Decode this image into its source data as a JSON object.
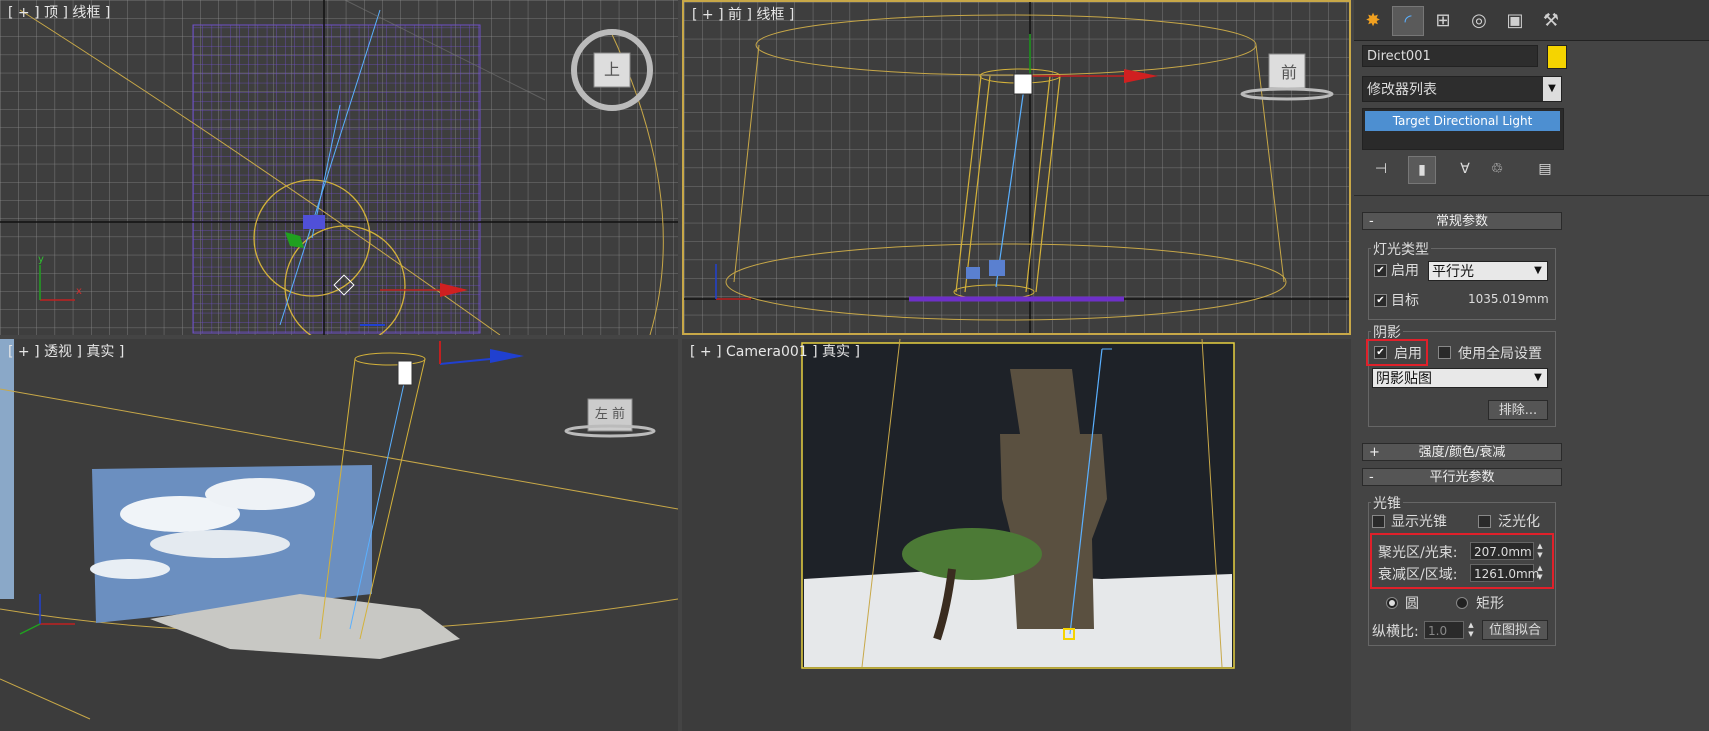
{
  "viewports": {
    "top": {
      "label": "[ + ] 顶 ] 线框 ]",
      "nav_cube": "上"
    },
    "front": {
      "label": "[ + ] 前 ] 线框 ]",
      "nav_cube": "前"
    },
    "perspective": {
      "label": "[ + ] 透视 ] 真实 ]",
      "nav_cube": "左 前"
    },
    "camera": {
      "label": "[ + ] Camera001 ] 真实 ]"
    }
  },
  "panel": {
    "tabs": [
      "create-icon",
      "modify-icon",
      "hierarchy-icon",
      "motion-icon",
      "display-icon",
      "utilities-icon"
    ],
    "object_name": "Direct001",
    "object_color": "#f5d400",
    "modifier_list": "修改器列表",
    "stack_item": "Target Directional Light",
    "general": {
      "sign": "-",
      "title": "常规参数",
      "light_type_group": "灯光类型",
      "on_label": "启用",
      "on_checked": true,
      "light_type": "平行光",
      "target_label": "目标",
      "target_checked": true,
      "target_distance": "1035.019mm",
      "shadows_group": "阴影",
      "shadow_on_label": "启用",
      "shadow_on_checked": true,
      "global_label": "使用全局设置",
      "global_checked": false,
      "shadow_type": "阴影贴图",
      "exclude_button": "排除..."
    },
    "intensity": {
      "sign": "+",
      "title": "强度/颜色/衰减"
    },
    "directional": {
      "sign": "-",
      "title": "平行光参数",
      "cone_group": "光锥",
      "show_cone_label": "显示光锥",
      "show_cone_checked": false,
      "overshoot_label": "泛光化",
      "overshoot_checked": false,
      "hotspot_label": "聚光区/光束:",
      "hotspot_value": "207.0mm",
      "falloff_label": "衰减区/区域:",
      "falloff_value": "1261.0mm",
      "circle_label": "圆",
      "circle_selected": true,
      "rect_label": "矩形",
      "aspect_label": "纵横比:",
      "aspect_value": "1.0",
      "bitmap_fit_button": "位图拟合"
    }
  },
  "colors": {
    "highlight_red": "#e0202a",
    "accent_blue": "#4d8fd1",
    "light_yellow": "#c8a848"
  }
}
